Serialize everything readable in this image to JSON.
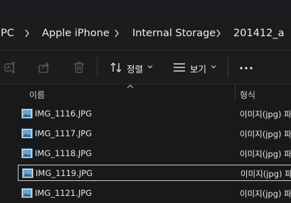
{
  "breadcrumb": {
    "items": [
      {
        "label": "PC"
      },
      {
        "label": "Apple iPhone"
      },
      {
        "label": "Internal Storage"
      },
      {
        "label": "201412_a"
      }
    ]
  },
  "toolbar": {
    "sort_label": "정렬",
    "view_label": "보기",
    "more_label": "•••"
  },
  "columns": {
    "name": "이름",
    "type": "형식"
  },
  "files": [
    {
      "name": "IMG_1116.JPG",
      "type": "이미지(jpg) 파"
    },
    {
      "name": "IMG_1117.JPG",
      "type": "이미지(jpg) 파"
    },
    {
      "name": "IMG_1118.JPG",
      "type": "이미지(jpg) 파"
    },
    {
      "name": "IMG_1119.JPG",
      "type": "이미지(jpg) 파",
      "selected": true
    },
    {
      "name": "IMG_1121.JPG",
      "type": "이미지(jpg) 파"
    }
  ],
  "colors": {
    "background": "#191919",
    "toolbar": "#1c1c1c",
    "text": "#e6e6e6",
    "selection_border": "#cfcfcf"
  }
}
